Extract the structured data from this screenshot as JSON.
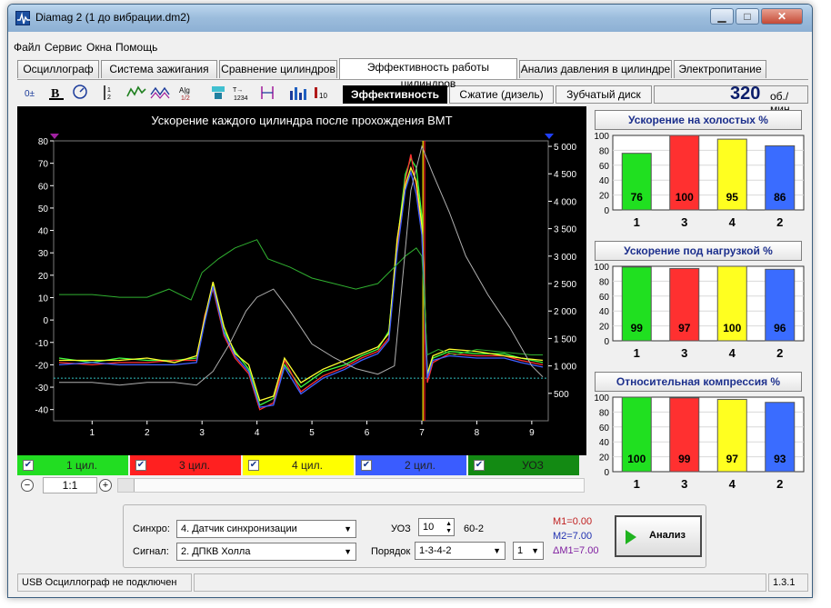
{
  "window": {
    "title": "Diamag 2 (1 до вибрации.dm2)",
    "controls": {
      "minimize": "▁",
      "maximize": "□",
      "close": "✕"
    }
  },
  "menu": [
    "Файл",
    "Сервис",
    "Окна",
    "Помощь"
  ],
  "tabs": [
    {
      "label": "Осциллограф",
      "active": false
    },
    {
      "label": "Система зажигания",
      "active": false
    },
    {
      "label": "Сравнение цилиндров",
      "active": false
    },
    {
      "label": "Эффективность работы цилиндров",
      "active": true
    },
    {
      "label": "Анализ давления в цилиндре",
      "active": false
    },
    {
      "label": "Электропитание",
      "active": false
    }
  ],
  "toolbar": {
    "icons": [
      "cursor-tool-icon",
      "bold-b-icon",
      "rpm-icon",
      "number-list-icon",
      "wave-icon",
      "multi-wave-icon",
      "abs-icon",
      "tree-icon",
      "x1234-icon",
      "marker-icon",
      "bar-chart-icon",
      "h10-icon"
    ],
    "subtabs": [
      {
        "label": "Эффективность",
        "active": true
      },
      {
        "label": "Сжатие (дизель)",
        "active": false
      },
      {
        "label": "Зубчатый диск",
        "active": false
      }
    ],
    "rpm": "320",
    "rpm_unit": "об./мин."
  },
  "chart": {
    "title": "Ускорение каждого цилиндра после прохождения ВМТ",
    "left_ticks": [
      "80",
      "70",
      "60",
      "50",
      "40",
      "30",
      "20",
      "10",
      "0",
      "-10",
      "-20",
      "-30",
      "-40"
    ],
    "right_ticks": [
      "5 000",
      "4 500",
      "4 000",
      "3 500",
      "3 000",
      "2 500",
      "2 000",
      "1 500",
      "1 000",
      "500"
    ],
    "x_ticks": [
      "1",
      "2",
      "3",
      "4",
      "5",
      "6",
      "7",
      "8",
      "9"
    ]
  },
  "chart_data": {
    "type": "line",
    "title": "Ускорение каждого цилиндра после прохождения ВМТ",
    "xlim": [
      0.3,
      9.3
    ],
    "ylim": [
      -45,
      80
    ],
    "y2lim": [
      0,
      5100
    ],
    "grid": false,
    "series": [
      {
        "name": "1 цил.",
        "color": "#40ff40",
        "axis": "left",
        "x": [
          0.4,
          1,
          1.5,
          2,
          2.5,
          2.9,
          3.05,
          3.2,
          3.4,
          3.6,
          3.85,
          4.05,
          4.3,
          4.5,
          4.8,
          5.2,
          5.6,
          5.9,
          6.2,
          6.4,
          6.55,
          6.7,
          6.8,
          6.9,
          7.0,
          7.1,
          7.2,
          7.5,
          8,
          8.5,
          8.8,
          9.2
        ],
        "y": [
          -17,
          -19,
          -17,
          -18,
          -18,
          -17,
          0,
          16,
          -5,
          -14,
          -22,
          -38,
          -35,
          -20,
          -30,
          -23,
          -20,
          -16,
          -13,
          -5,
          34,
          65,
          72,
          68,
          46,
          -25,
          -17,
          -14,
          -15,
          -15,
          -17,
          -19
        ]
      },
      {
        "name": "3 цил.",
        "color": "#ff3030",
        "axis": "left",
        "x": [
          0.4,
          1,
          1.5,
          2,
          2.5,
          2.9,
          3.05,
          3.2,
          3.4,
          3.6,
          3.85,
          4.05,
          4.3,
          4.5,
          4.8,
          5.2,
          5.6,
          5.9,
          6.2,
          6.4,
          6.55,
          6.7,
          6.8,
          6.9,
          7.0,
          7.1,
          7.2,
          7.5,
          8,
          8.5,
          8.8,
          9.2
        ],
        "y": [
          -19,
          -20,
          -19,
          -19,
          -18,
          -18,
          2,
          14,
          -7,
          -17,
          -24,
          -40,
          -37,
          -18,
          -32,
          -25,
          -21,
          -17,
          -14,
          -8,
          32,
          62,
          74,
          60,
          40,
          -28,
          -19,
          -15,
          -16,
          -16,
          -18,
          -20
        ]
      },
      {
        "name": "4 цил.",
        "color": "#ffff30",
        "axis": "left",
        "x": [
          0.4,
          1,
          1.5,
          2,
          2.5,
          2.9,
          3.05,
          3.2,
          3.4,
          3.6,
          3.85,
          4.05,
          4.3,
          4.5,
          4.8,
          5.2,
          5.6,
          5.9,
          6.2,
          6.4,
          6.55,
          6.7,
          6.8,
          6.9,
          7.0,
          7.1,
          7.2,
          7.5,
          8,
          8.5,
          8.8,
          9.2
        ],
        "y": [
          -18,
          -18,
          -18,
          -17,
          -19,
          -16,
          1,
          17,
          -3,
          -15,
          -20,
          -36,
          -34,
          -17,
          -28,
          -22,
          -18,
          -15,
          -12,
          -6,
          36,
          60,
          68,
          62,
          42,
          -24,
          -16,
          -13,
          -14,
          -16,
          -17,
          -18
        ]
      },
      {
        "name": "2 цил.",
        "color": "#4060ff",
        "axis": "left",
        "x": [
          0.4,
          1,
          1.5,
          2,
          2.5,
          2.9,
          3.05,
          3.2,
          3.4,
          3.6,
          3.85,
          4.05,
          4.3,
          4.5,
          4.8,
          5.2,
          5.6,
          5.9,
          6.2,
          6.4,
          6.55,
          6.7,
          6.8,
          6.9,
          7.0,
          7.1,
          7.2,
          7.5,
          8,
          8.5,
          8.8,
          9.2
        ],
        "y": [
          -20,
          -19,
          -20,
          -20,
          -20,
          -19,
          -1,
          15,
          -6,
          -16,
          -23,
          -39,
          -38,
          -21,
          -33,
          -26,
          -22,
          -18,
          -15,
          -9,
          30,
          58,
          66,
          56,
          38,
          -26,
          -18,
          -16,
          -17,
          -17,
          -19,
          -21
        ]
      },
      {
        "name": "",
        "color": "#30b030",
        "axis": "right",
        "x": [
          0.4,
          1,
          1.5,
          2,
          2.4,
          2.8,
          3.0,
          3.3,
          3.6,
          4.0,
          4.2,
          4.6,
          5.0,
          5.4,
          5.8,
          6.2,
          6.5,
          6.7,
          6.9,
          7.0,
          7.1,
          7.3,
          7.6,
          8.0,
          8.5,
          9.0,
          9.2
        ],
        "y": [
          2300,
          2300,
          2250,
          2250,
          2400,
          2200,
          2700,
          2950,
          3150,
          3300,
          2950,
          2800,
          2600,
          2500,
          2400,
          2500,
          2800,
          3000,
          3150,
          3000,
          1200,
          1300,
          1200,
          1300,
          1250,
          1200,
          1200
        ]
      },
      {
        "name": "",
        "color": "#b0b0b0",
        "axis": "right",
        "x": [
          0.4,
          1,
          1.5,
          2,
          2.5,
          2.9,
          3.2,
          3.5,
          3.8,
          4.0,
          4.3,
          4.6,
          5.0,
          5.4,
          5.8,
          6.2,
          6.5,
          6.8,
          7.0,
          7.2,
          7.5,
          7.8,
          8.2,
          8.6,
          9.0,
          9.2
        ],
        "y": [
          700,
          700,
          650,
          700,
          700,
          650,
          900,
          1400,
          2000,
          2250,
          2400,
          2000,
          1400,
          1150,
          950,
          850,
          1000,
          4200,
          5000,
          4500,
          3800,
          3000,
          2300,
          1700,
          1000,
          800
        ]
      }
    ],
    "reference_lines": [
      {
        "axis": "left",
        "value": -26,
        "color": "#30c0c0"
      },
      {
        "axis": "x",
        "value": 7.02,
        "color": "#ffee00"
      },
      {
        "axis": "x",
        "value": 7.05,
        "color": "#ff2020"
      }
    ],
    "bar_groups": [
      {
        "title": "Ускорение на холостых %",
        "categories": [
          "1",
          "3",
          "4",
          "2"
        ],
        "values": [
          76,
          100,
          95,
          86
        ],
        "ylim": [
          0,
          100
        ]
      },
      {
        "title": "Ускорение под нагрузкой %",
        "categories": [
          "1",
          "3",
          "4",
          "2"
        ],
        "values": [
          99,
          97,
          100,
          96
        ],
        "ylim": [
          0,
          100
        ]
      },
      {
        "title": "Относительная компрессия %",
        "categories": [
          "1",
          "3",
          "4",
          "2"
        ],
        "values": [
          100,
          99,
          97,
          93
        ],
        "ylim": [
          0,
          100
        ]
      }
    ],
    "bar_colors": [
      "#20e020",
      "#ff3030",
      "#ffff20",
      "#3a6cff"
    ],
    "bar_ticks": [
      "100",
      "80",
      "60",
      "40",
      "20",
      "0"
    ]
  },
  "cylinders": [
    {
      "label": "1 цил.",
      "color": "#22dd22",
      "checked": "✔"
    },
    {
      "label": "3 цил.",
      "color": "#ff2020",
      "checked": "✔"
    },
    {
      "label": "4 цил.",
      "color": "#ffff00",
      "checked": "✔"
    },
    {
      "label": "2 цил.",
      "color": "#3a5cff",
      "checked": "✔"
    },
    {
      "label": "УОЗ",
      "color": "#138a13",
      "checked": "✔"
    }
  ],
  "zoom": {
    "minus": "−",
    "value": "1:1",
    "plus": "+"
  },
  "controls": {
    "sync_label": "Синхро:",
    "sync_value": "4.  Датчик синхронизации",
    "signal_label": "Сигнал:",
    "signal_value": "2.  ДПКВ Холла",
    "uoz_label": "УОЗ",
    "uoz_value": "10",
    "wheel_value": "60-2",
    "order_label": "Порядок",
    "order_value": "1-3-4-2",
    "order_num": "1",
    "m1": "M1=0.00",
    "m2": "M2=7.00",
    "dm1": "ΔM1=7.00",
    "analysis": "Анализ"
  },
  "status": {
    "connection": "USB Осциллограф не подключен",
    "version": "1.3.1"
  }
}
